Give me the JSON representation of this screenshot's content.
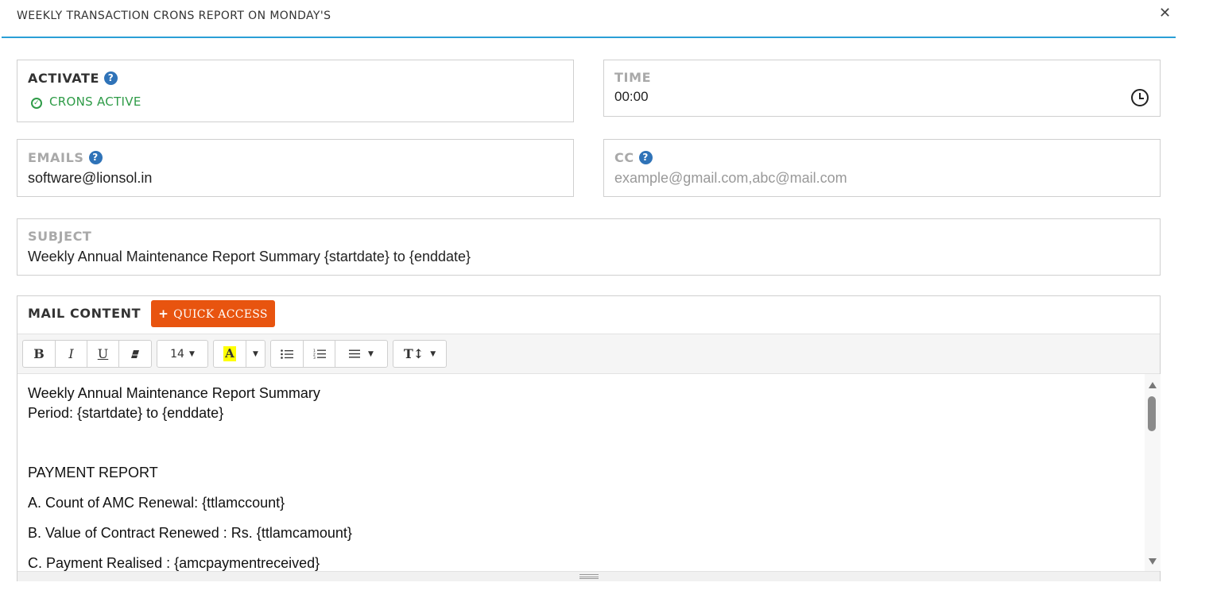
{
  "modal": {
    "title": "WEEKLY TRANSACTION CRONS REPORT ON MONDAY'S",
    "close_icon": "close-icon"
  },
  "activate": {
    "label": "ACTIVATE",
    "help": "?",
    "status_text": "CRONS ACTIVE",
    "status_icon": "check-circle-icon",
    "status_color": "#2e9b47"
  },
  "time": {
    "label": "TIME",
    "value": "00:00",
    "icon": "clock-icon"
  },
  "emails": {
    "label": "EMAILS",
    "help": "?",
    "value": "software@lionsol.in"
  },
  "cc": {
    "label": "CC",
    "help": "?",
    "placeholder": "example@gmail.com,abc@mail.com"
  },
  "subject": {
    "label": "SUBJECT",
    "value": "Weekly Annual Maintenance Report Summary {startdate} to {enddate}"
  },
  "mail_content": {
    "label": "MAIL CONTENT",
    "quick_access_label": "QUICK ACCESS",
    "quick_access_color": "#e8540f",
    "toolbar": {
      "bold": "B",
      "italic": "I",
      "underline": "U",
      "font_size": "14",
      "highlight": "A",
      "text_size": "T↕"
    },
    "body": [
      "Weekly Annual Maintenance Report Summary",
      "Period: {startdate} to {enddate}",
      "PAYMENT REPORT",
      "A. Count of AMC Renewal: {ttlamccount}",
      "B. Value of Contract Renewed : Rs. {ttlamcamount}",
      "C. Payment Realised : {amcpaymentreceived}"
    ]
  },
  "accent_color": "#2a9fd6"
}
